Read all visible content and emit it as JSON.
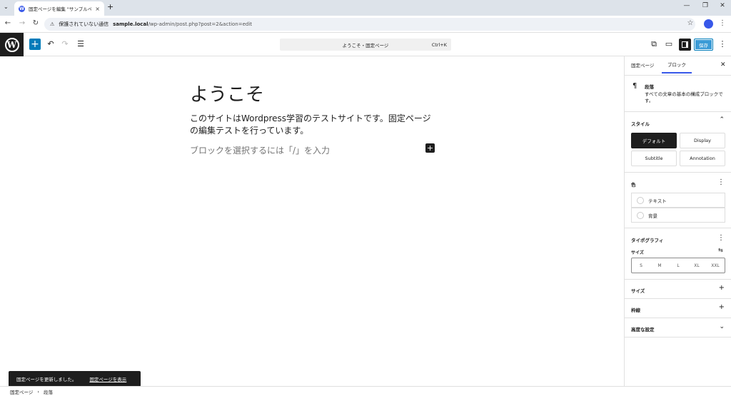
{
  "browser": {
    "tab_title": "固定ページを編集 \"サンプルページ\"",
    "address": {
      "security_label": "保護されていない通信",
      "host": "sample.local",
      "path": "/wp-admin/post.php?post=2&action=edit"
    }
  },
  "editor_header": {
    "command_bar": "ようこそ・固定ページ",
    "shortcut": "Ctrl+K",
    "save_label": "保存"
  },
  "canvas": {
    "post_title": "ようこそ",
    "paragraph": "このサイトはWordpress学習のテストサイトです。固定ページの編集テストを行っています。",
    "block_placeholder": "ブロックを選択するには「/」を入力"
  },
  "sidebar": {
    "tabs": [
      "固定ページ",
      "ブロック"
    ],
    "block": {
      "name": "段落",
      "description": "すべての文章の基本の構成ブロックです。"
    },
    "styles": {
      "heading": "スタイル",
      "options": [
        "デフォルト",
        "Display",
        "Subtitle",
        "Annotation"
      ]
    },
    "color": {
      "heading": "色",
      "items": [
        "テキスト",
        "背景"
      ]
    },
    "typography": {
      "heading": "タイポグラフィ",
      "size_label": "サイズ",
      "sizes": [
        "S",
        "M",
        "L",
        "XL",
        "XXL"
      ]
    },
    "dimensions_heading": "サイズ",
    "border_heading": "枠線",
    "advanced_heading": "高度な設定"
  },
  "snackbar": {
    "message": "固定ページを更新しました。",
    "link": "固定ページを表示"
  },
  "breadcrumb": {
    "root": "固定ページ",
    "current": "段落"
  }
}
